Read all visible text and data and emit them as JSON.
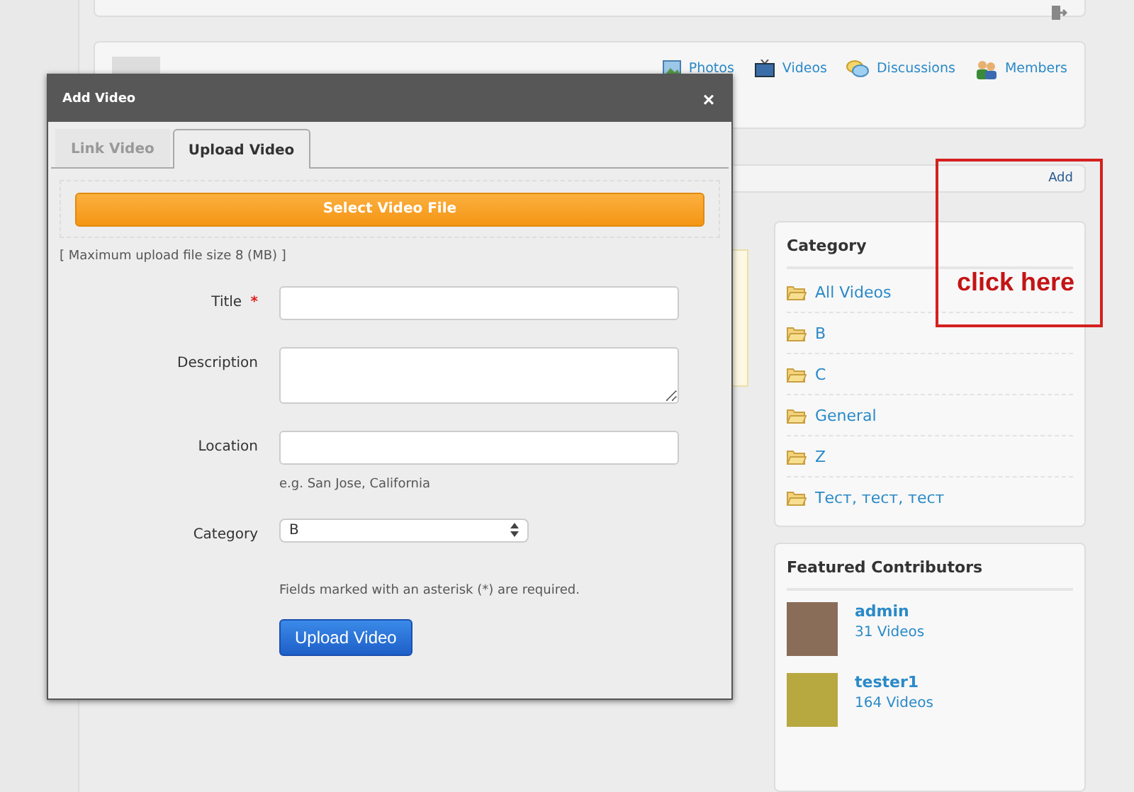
{
  "group_header": {
    "links": [
      {
        "label": "Photos"
      },
      {
        "label": "Videos"
      },
      {
        "label": "Discussions"
      },
      {
        "label": "Members"
      }
    ]
  },
  "videos_bar": {
    "add_link": "Add"
  },
  "category": {
    "title": "Category",
    "items": [
      "All Videos",
      "B",
      "C",
      "General",
      "Z",
      "Тест, тест, тест"
    ]
  },
  "featured_contributors": {
    "title": "Featured Contributors",
    "people": [
      {
        "name": "admin",
        "count": "31 Videos"
      },
      {
        "name": "tester1",
        "count": "164 Videos"
      }
    ]
  },
  "annotation": {
    "text": "click here"
  },
  "dialog": {
    "title": "Add Video",
    "close": "×",
    "tabs": [
      {
        "label": "Link Video",
        "selected": false
      },
      {
        "label": "Upload Video",
        "selected": true
      }
    ],
    "select_button": "Select Video File",
    "required_mark": "*",
    "max_size": "[ Maximum upload file size 8 (MB) ]",
    "fields": [
      {
        "kind": "text",
        "label": "Title",
        "required": true
      },
      {
        "kind": "textarea",
        "label": "Description",
        "required": false
      },
      {
        "kind": "text",
        "label": "Location",
        "required": false,
        "hint": "e.g. San Jose, California"
      },
      {
        "kind": "select",
        "label": "Category",
        "required": false,
        "value": "B"
      }
    ],
    "required_note": "Fields marked with an asterisk (*) are required.",
    "submit": "Upload Video"
  }
}
